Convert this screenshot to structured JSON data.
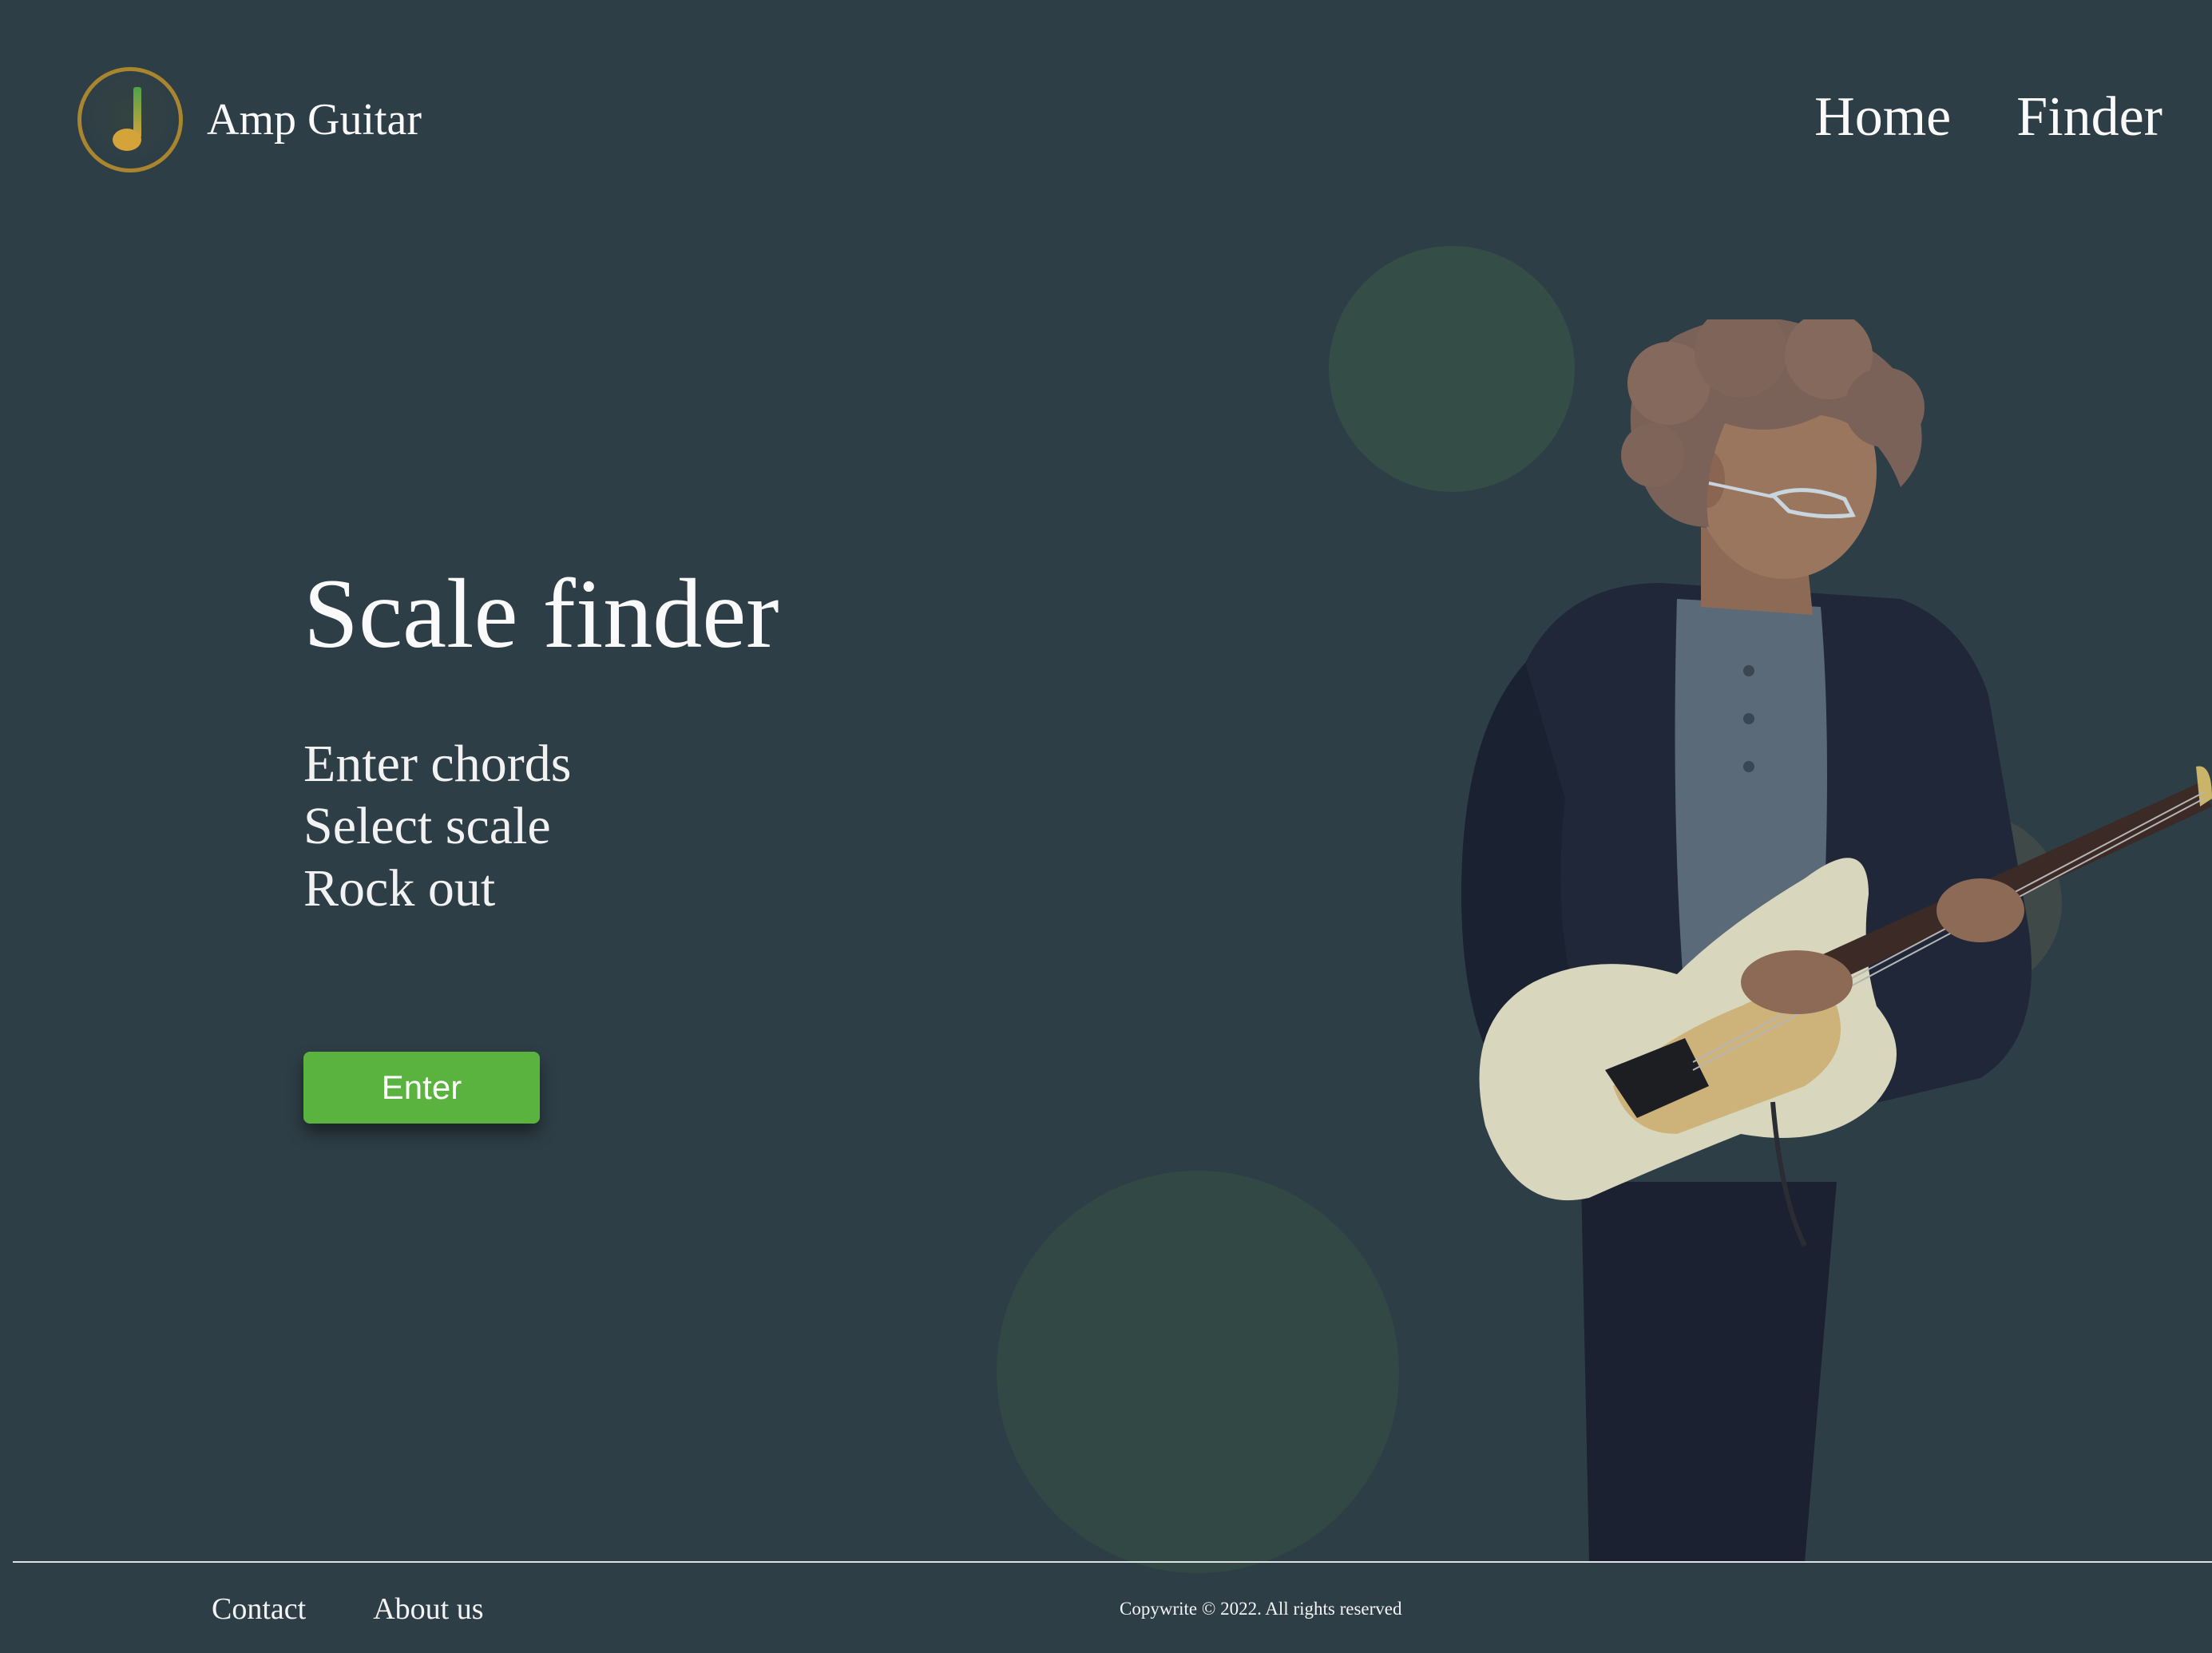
{
  "header": {
    "brand": "Amp Guitar",
    "logo_icon": "music-note-icon",
    "nav": [
      "Home",
      "Finder"
    ]
  },
  "hero": {
    "title": "Scale finder",
    "steps": [
      "Enter chords",
      "Select scale",
      "Rock out"
    ],
    "cta_label": "Enter"
  },
  "footer": {
    "links": [
      "Contact",
      "About us"
    ],
    "copyright": "Copywrite © 2022. All rights reserved"
  },
  "colors": {
    "background": "#2e3e47",
    "accent_green": "#5ab33e",
    "logo_ring": "#a9862e",
    "text": "#fafafa"
  }
}
